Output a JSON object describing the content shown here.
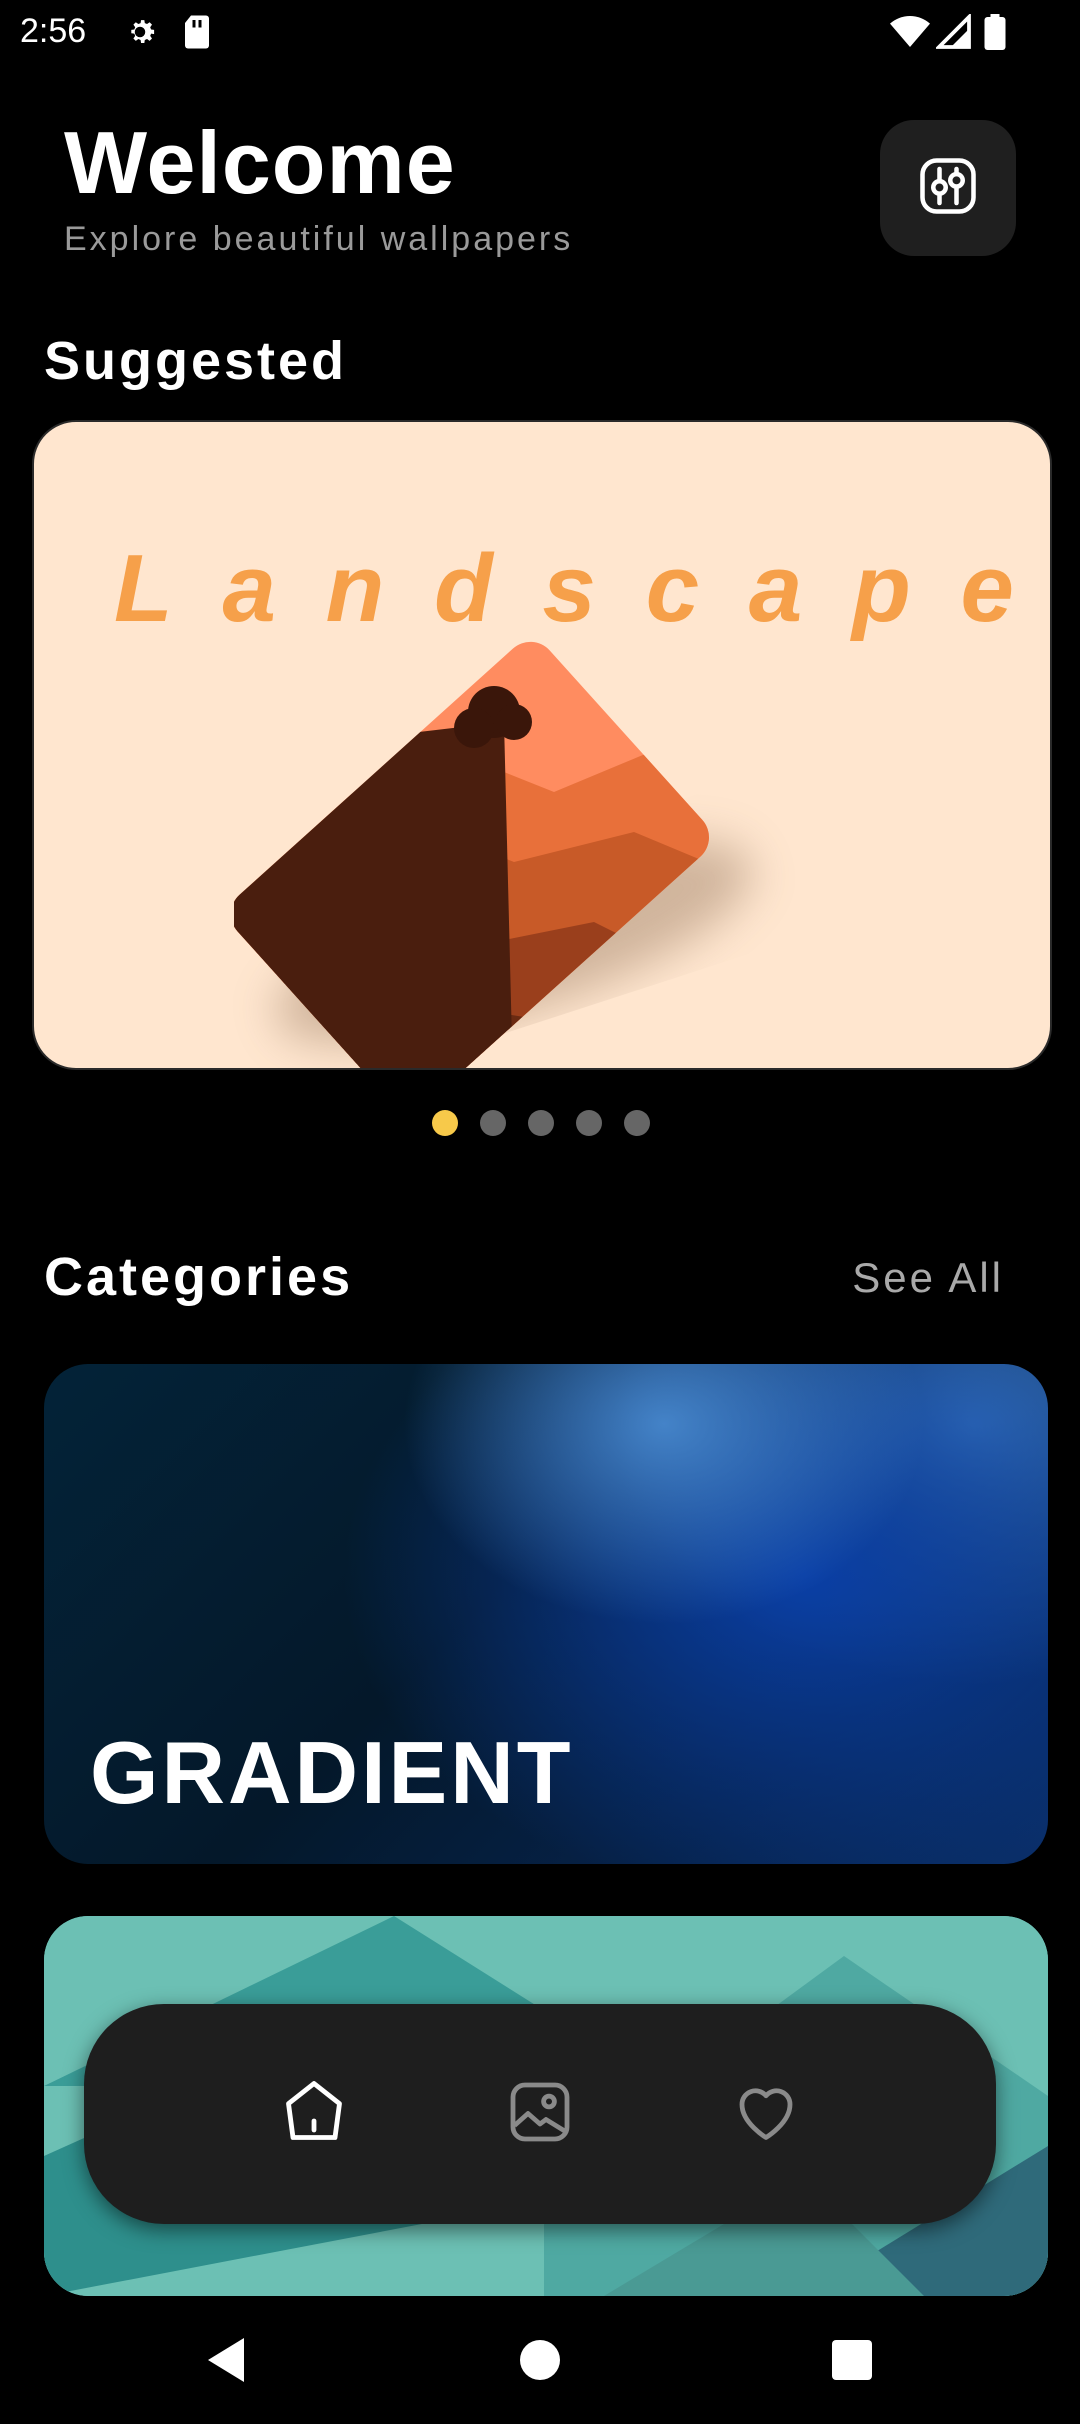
{
  "status_bar": {
    "time": "2:56",
    "icons": [
      "gear-icon",
      "sd-card-icon",
      "wifi-icon",
      "signal-icon",
      "battery-icon"
    ]
  },
  "header": {
    "title": "Welcome",
    "subtitle": "Explore beautiful wallpapers",
    "filter_icon": "sliders-icon"
  },
  "suggested": {
    "title": "Suggested",
    "card_text": [
      "L",
      "a",
      "n",
      "d",
      "s",
      "c",
      "a",
      "p",
      "e"
    ],
    "page_count": 5,
    "active_page": 1
  },
  "categories": {
    "title": "Categories",
    "see_all": "See All",
    "items": [
      {
        "label": "GRADIENT"
      },
      {
        "label": ""
      }
    ]
  },
  "bottom_nav": {
    "items": [
      {
        "icon": "home-icon",
        "active": true
      },
      {
        "icon": "image-icon",
        "active": false
      },
      {
        "icon": "heart-icon",
        "active": false
      }
    ]
  },
  "system_nav": [
    "back-icon",
    "home-circle-icon",
    "recents-icon"
  ],
  "colors": {
    "accent": "#f7c94a",
    "background": "#000000",
    "nav_background": "#1e1e1e",
    "card_landscape_bg": "#ffe6cf",
    "landscape_text": "#f6a04a"
  }
}
